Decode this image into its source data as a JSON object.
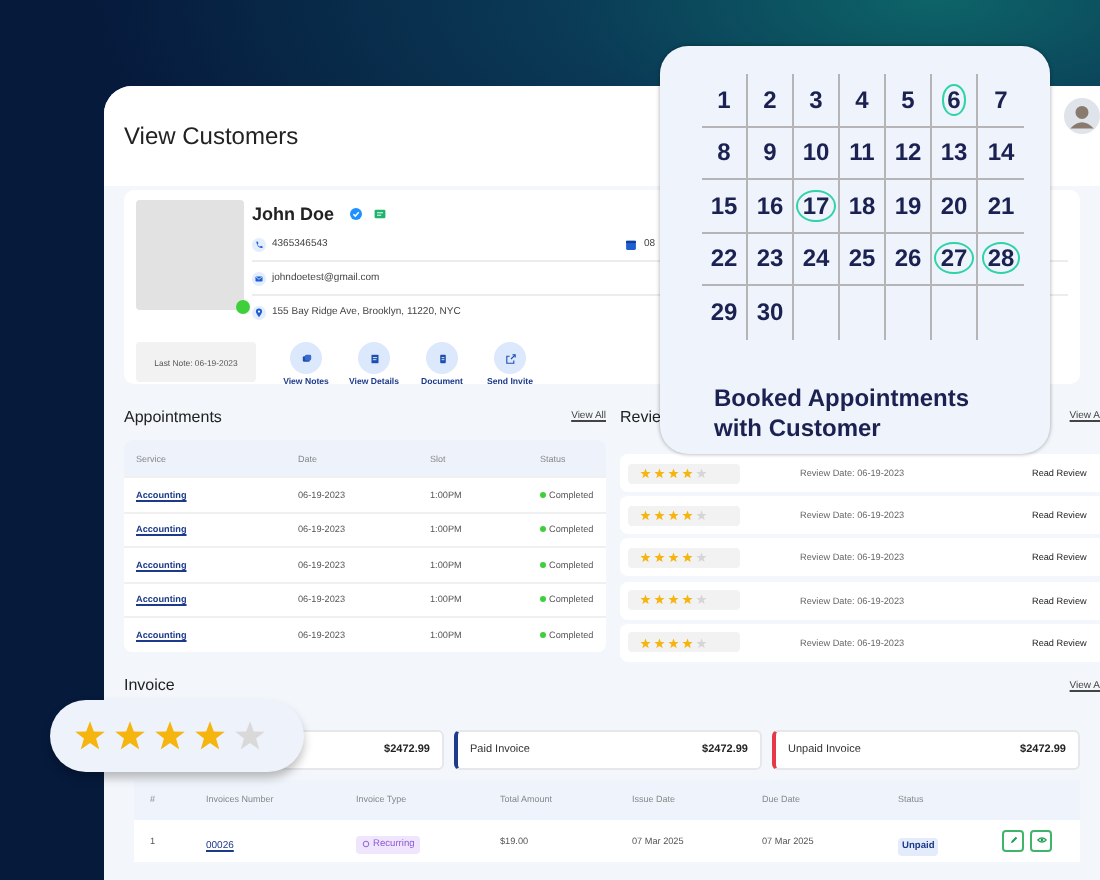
{
  "window": {
    "title": "View Customers"
  },
  "customer": {
    "name": "John Doe",
    "verified": true,
    "online": true,
    "phone": "4365346543",
    "date": "08",
    "email": "johndoetest@gmail.com",
    "address": "155 Bay Ridge Ave, Brooklyn, 11220, NYC",
    "last_note": "Last Note: 06-19-2023",
    "actions": [
      {
        "label": "View Notes",
        "kind": "notes"
      },
      {
        "label": "View Details",
        "kind": "details"
      },
      {
        "label": "Document",
        "kind": "document"
      },
      {
        "label": "Send Invite",
        "kind": "invite"
      }
    ]
  },
  "appointments": {
    "title": "Appointments",
    "view_all": "View All",
    "columns": [
      "Service",
      "Date",
      "Slot",
      "Status"
    ],
    "rows": [
      {
        "service": "Accounting",
        "date": "06-19-2023",
        "slot": "1:00PM",
        "status": "Completed"
      },
      {
        "service": "Accounting",
        "date": "06-19-2023",
        "slot": "1:00PM",
        "status": "Completed"
      },
      {
        "service": "Accounting",
        "date": "06-19-2023",
        "slot": "1:00PM",
        "status": "Completed"
      },
      {
        "service": "Accounting",
        "date": "06-19-2023",
        "slot": "1:00PM",
        "status": "Completed"
      },
      {
        "service": "Accounting",
        "date": "06-19-2023",
        "slot": "1:00PM",
        "status": "Completed"
      }
    ]
  },
  "reviews": {
    "title": "Revie",
    "view_all": "View A",
    "rows": [
      {
        "stars": 4,
        "date": "Review Date: 06-19-2023",
        "link": "Read Review"
      },
      {
        "stars": 4,
        "date": "Review Date: 06-19-2023",
        "link": "Read Review"
      },
      {
        "stars": 4,
        "date": "Review Date: 06-19-2023",
        "link": "Read Review"
      },
      {
        "stars": 4,
        "date": "Review Date: 06-19-2023",
        "link": "Read Review"
      },
      {
        "stars": 4,
        "date": "Review Date: 06-19-2023",
        "link": "Read Review"
      }
    ]
  },
  "invoice": {
    "title": "Invoice",
    "view_all": "View A",
    "summary": [
      {
        "kind": "total",
        "amount": "$2472.99"
      },
      {
        "kind": "paid",
        "label": "Paid Invoice",
        "amount": "$2472.99"
      },
      {
        "kind": "unpaid",
        "label": "Unpaid Invoice",
        "amount": "$2472.99"
      }
    ],
    "columns": [
      "#",
      "Invoices Number",
      "Invoice Type",
      "Total Amount",
      "Issue Date",
      "Due Date",
      "Status"
    ],
    "rows": [
      {
        "no": "1",
        "number": "00026",
        "type": "Recurring",
        "total": "$19.00",
        "issue": "07 Mar 2025",
        "due": "07 Mar 2025",
        "status": "Unpaid"
      }
    ]
  },
  "rating_badge": {
    "stars": 4
  },
  "calendar": {
    "caption": "Booked Appointments with Customer",
    "days": [
      {
        "day": "1",
        "booked": false
      },
      {
        "day": "2",
        "booked": false
      },
      {
        "day": "3",
        "booked": false
      },
      {
        "day": "4",
        "booked": false
      },
      {
        "day": "5",
        "booked": false
      },
      {
        "day": "6",
        "booked": true
      },
      {
        "day": "7",
        "booked": false
      },
      {
        "day": "8",
        "booked": false
      },
      {
        "day": "9",
        "booked": false
      },
      {
        "day": "10",
        "booked": false
      },
      {
        "day": "11",
        "booked": false
      },
      {
        "day": "12",
        "booked": false
      },
      {
        "day": "13",
        "booked": false
      },
      {
        "day": "14",
        "booked": false
      },
      {
        "day": "15",
        "booked": false
      },
      {
        "day": "16",
        "booked": false
      },
      {
        "day": "17",
        "booked": true
      },
      {
        "day": "18",
        "booked": false
      },
      {
        "day": "19",
        "booked": false
      },
      {
        "day": "20",
        "booked": false
      },
      {
        "day": "21",
        "booked": false
      },
      {
        "day": "22",
        "booked": false
      },
      {
        "day": "23",
        "booked": false
      },
      {
        "day": "24",
        "booked": false
      },
      {
        "day": "25",
        "booked": false
      },
      {
        "day": "26",
        "booked": false
      },
      {
        "day": "27",
        "booked": true
      },
      {
        "day": "28",
        "booked": true
      },
      {
        "day": "29",
        "booked": false
      },
      {
        "day": "30",
        "booked": false
      }
    ]
  }
}
